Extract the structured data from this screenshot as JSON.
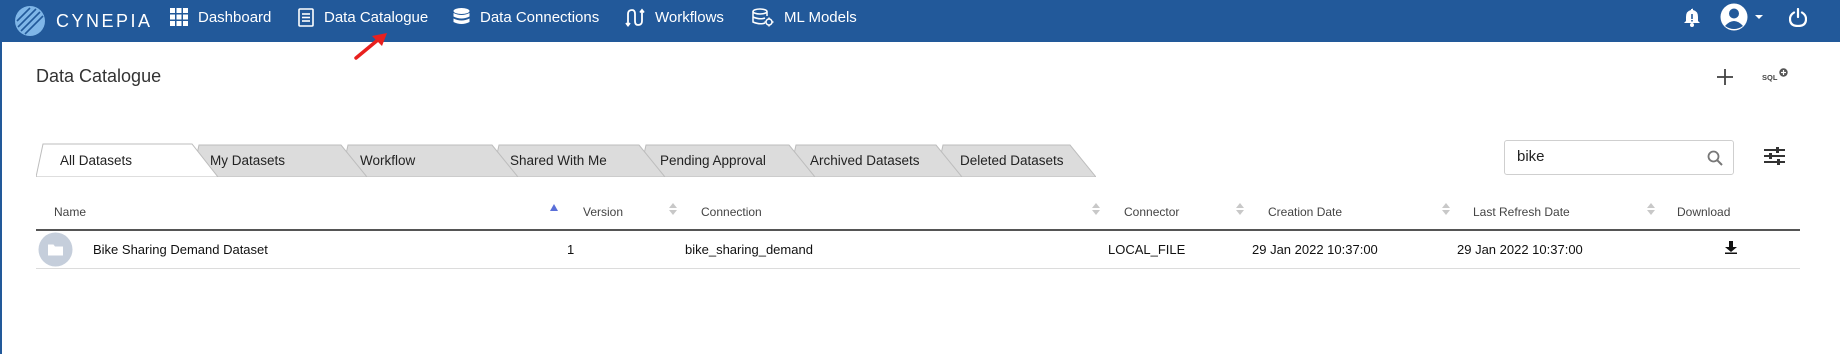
{
  "app": {
    "brand": "CYNEPIA"
  },
  "nav": [
    {
      "label": "Dashboard",
      "icon": "grid-icon"
    },
    {
      "label": "Data Catalogue",
      "icon": "document-icon",
      "active": true
    },
    {
      "label": "Data Connections",
      "icon": "database-icon"
    },
    {
      "label": "Workflows",
      "icon": "workflow-icon"
    },
    {
      "label": "ML Models",
      "icon": "ml-model-icon"
    }
  ],
  "header_icons": [
    "bell-icon",
    "user-avatar-icon",
    "caret-down-icon",
    "power-icon"
  ],
  "page": {
    "title": "Data Catalogue",
    "add_icon": "plus-icon",
    "sql_icon_text": "SQL"
  },
  "tabs": [
    {
      "label": "All Datasets",
      "active": true
    },
    {
      "label": "My Datasets"
    },
    {
      "label": "Workflow"
    },
    {
      "label": "Shared With Me"
    },
    {
      "label": "Pending Approval"
    },
    {
      "label": "Archived Datasets"
    },
    {
      "label": "Deleted Datasets"
    }
  ],
  "search": {
    "value": "bike"
  },
  "table": {
    "columns": [
      "Name",
      "Version",
      "Connection",
      "Connector",
      "Creation Date",
      "Last Refresh Date",
      "Download"
    ],
    "sorted_column": "Name",
    "sort_direction": "ascending",
    "rows": [
      {
        "name": "Bike Sharing Demand Dataset",
        "version": "1",
        "connection": "bike_sharing_demand",
        "connector": "LOCAL_FILE",
        "creation_date": "29 Jan 2022 10:37:00",
        "last_refresh_date": "29 Jan 2022 10:37:00"
      }
    ]
  },
  "colors": {
    "header_bg": "#22599a",
    "tab_inactive": "#dcdcdc",
    "tab_active": "#ffffff",
    "annotation_arrow": "#e8201e"
  }
}
